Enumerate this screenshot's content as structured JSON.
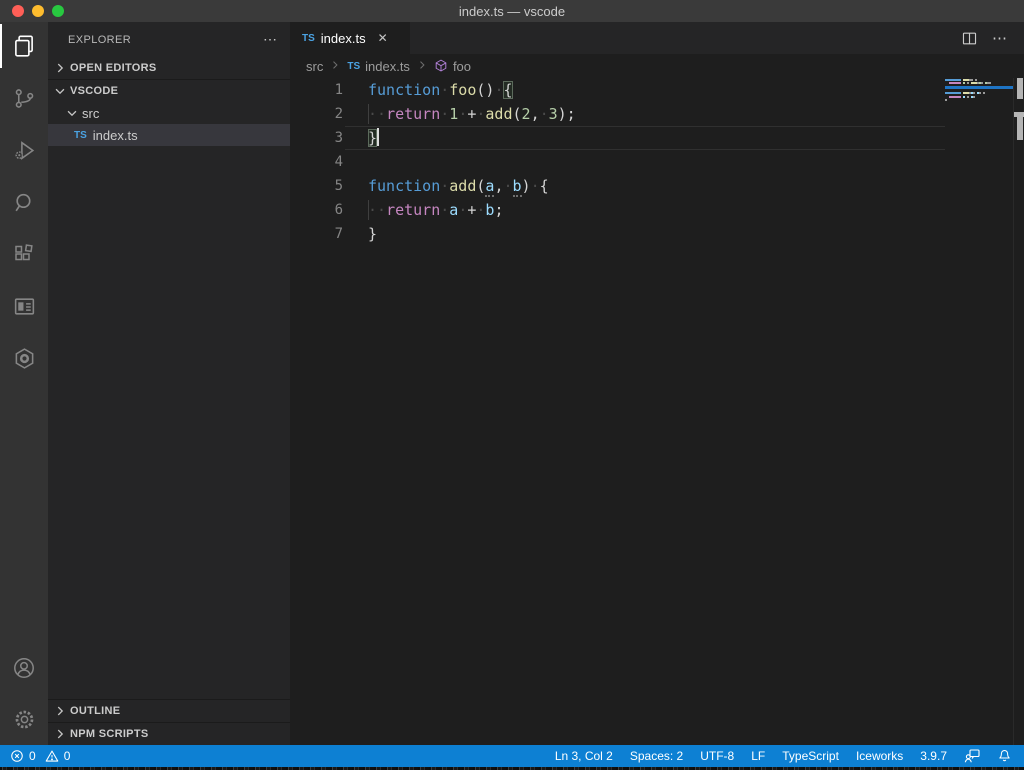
{
  "window": {
    "title": "index.ts — vscode"
  },
  "activity_bar": {
    "items": [
      {
        "name": "explorer",
        "active": true
      },
      {
        "name": "source-control",
        "active": false
      },
      {
        "name": "run-and-debug",
        "active": false
      },
      {
        "name": "search",
        "active": false
      },
      {
        "name": "extensions",
        "active": false
      },
      {
        "name": "iceworks-pages",
        "active": false
      },
      {
        "name": "iceworks",
        "active": false
      }
    ],
    "bottom": [
      {
        "name": "accounts"
      },
      {
        "name": "settings"
      }
    ]
  },
  "sidebar": {
    "title": "EXPLORER",
    "more_actions": "⋯",
    "sections": [
      {
        "label": "OPEN EDITORS",
        "collapsed": true
      },
      {
        "label": "VSCODE",
        "collapsed": false
      }
    ],
    "tree": [
      {
        "label": "src",
        "type": "folder",
        "expanded": true
      },
      {
        "label": "index.ts",
        "type": "typescript",
        "badge": "TS",
        "selected": true
      }
    ],
    "bottom_sections": [
      {
        "label": "OUTLINE"
      },
      {
        "label": "NPM SCRIPTS"
      }
    ]
  },
  "editor": {
    "tab": {
      "badge": "TS",
      "label": "index.ts",
      "close": "✕"
    },
    "actions": {
      "more": "⋯"
    },
    "breadcrumb": [
      {
        "label": "src"
      },
      {
        "label": "index.ts",
        "badge": "TS"
      },
      {
        "label": "foo",
        "icon": "symbol-function"
      }
    ],
    "code": {
      "language": "typescript",
      "lines": [
        {
          "n": "1",
          "tokens": [
            {
              "t": "function",
              "c": "kw"
            },
            {
              "t": "·",
              "c": "ws"
            },
            {
              "t": "foo",
              "c": "fn"
            },
            {
              "t": "()",
              "c": "pn"
            },
            {
              "t": "·",
              "c": "ws"
            },
            {
              "t": "{",
              "c": "pn",
              "bm": true
            }
          ]
        },
        {
          "n": "2",
          "guide": true,
          "tokens": [
            {
              "t": "··",
              "c": "ws"
            },
            {
              "t": "return",
              "c": "ctrl"
            },
            {
              "t": "·",
              "c": "ws"
            },
            {
              "t": "1",
              "c": "num"
            },
            {
              "t": "·",
              "c": "ws"
            },
            {
              "t": "+",
              "c": "pn"
            },
            {
              "t": "·",
              "c": "ws"
            },
            {
              "t": "add",
              "c": "fn"
            },
            {
              "t": "(",
              "c": "pn"
            },
            {
              "t": "2",
              "c": "num"
            },
            {
              "t": ",",
              "c": "pn"
            },
            {
              "t": "·",
              "c": "ws"
            },
            {
              "t": "3",
              "c": "num"
            },
            {
              "t": ");",
              "c": "pn"
            }
          ]
        },
        {
          "n": "3",
          "current": true,
          "tokens": [
            {
              "t": "}",
              "c": "pn",
              "bm": true
            },
            {
              "t": "",
              "c": "cursor"
            }
          ]
        },
        {
          "n": "4",
          "tokens": []
        },
        {
          "n": "5",
          "tokens": [
            {
              "t": "function",
              "c": "kw"
            },
            {
              "t": "·",
              "c": "ws"
            },
            {
              "t": "add",
              "c": "fn"
            },
            {
              "t": "(",
              "c": "pn"
            },
            {
              "t": "a",
              "c": "vr",
              "u": true
            },
            {
              "t": ",",
              "c": "pn"
            },
            {
              "t": "·",
              "c": "ws"
            },
            {
              "t": "b",
              "c": "vr",
              "u": true
            },
            {
              "t": ")",
              "c": "pn"
            },
            {
              "t": "·",
              "c": "ws"
            },
            {
              "t": "{",
              "c": "pn"
            }
          ]
        },
        {
          "n": "6",
          "guide": true,
          "tokens": [
            {
              "t": "··",
              "c": "ws"
            },
            {
              "t": "return",
              "c": "ctrl"
            },
            {
              "t": "·",
              "c": "ws"
            },
            {
              "t": "a",
              "c": "vr"
            },
            {
              "t": "·",
              "c": "ws"
            },
            {
              "t": "+",
              "c": "pn"
            },
            {
              "t": "·",
              "c": "ws"
            },
            {
              "t": "b",
              "c": "vr"
            },
            {
              "t": ";",
              "c": "pn"
            }
          ]
        },
        {
          "n": "7",
          "tokens": [
            {
              "t": "}",
              "c": "pn"
            }
          ]
        }
      ]
    }
  },
  "status_bar": {
    "errors": "0",
    "warnings": "0",
    "right_items": [
      "Ln 3, Col 2",
      "Spaces: 2",
      "UTF-8",
      "LF",
      "TypeScript",
      "Iceworks",
      "3.9.7"
    ]
  },
  "colors": {
    "status_bar_bg": "#0d80d3",
    "keyword_blue": "#569cd6",
    "function_yellow": "#dcdcaa",
    "control_pink": "#c586c0",
    "number_green": "#b5cea8",
    "variable_blue": "#9cdcfe",
    "ts_badge_blue": "#4ba3e3",
    "symbol_purple": "#b180d7",
    "selection_row_bg": "#37373d"
  }
}
